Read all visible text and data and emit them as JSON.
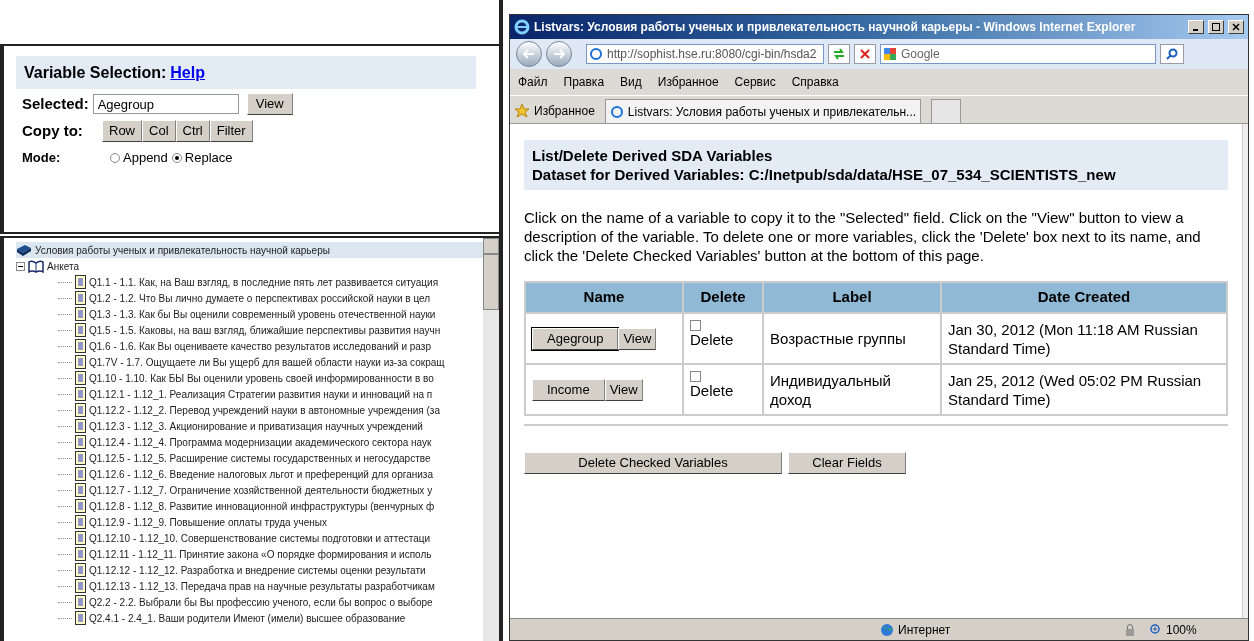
{
  "variable_selection": {
    "title": "Variable Selection:",
    "help_link": "Help",
    "selected_label": "Selected:",
    "selected_value": "Agegroup",
    "view_button": "View",
    "copy_label": "Copy to:",
    "copy_buttons": [
      "Row",
      "Col",
      "Ctrl",
      "Filter"
    ],
    "mode_label": "Mode:",
    "modes": [
      {
        "label": "Append",
        "selected": false
      },
      {
        "label": "Replace",
        "selected": true
      }
    ]
  },
  "tree": {
    "label": "Условия работы ученых и привлекательность научной карьеры",
    "children": [
      {
        "label": "Анкета",
        "expanded": true,
        "children": [
          {
            "label": "Q1.1 - 1.1. Как, на Ваш взгляд, в последние пять лет развивается ситуация"
          },
          {
            "label": "Q1.2 - 1.2. Что Вы лично думаете о перспективах российской науки в цел"
          },
          {
            "label": "Q1.3 - 1.3. Как бы Вы оценили современный уровень отечественной науки"
          },
          {
            "label": "Q1.5 - 1.5. Каковы, на ваш взгляд, ближайшие перспективы развития научн"
          },
          {
            "label": "Q1.6 - 1.6. Как Вы оцениваете качество результатов исследований и разр"
          },
          {
            "label": "Q1.7V - 1.7. Ощущаете ли Вы ущерб для вашей области науки из-за сокращ"
          },
          {
            "label": "Q1.10 - 1.10. Как БЫ Вы оценили уровень своей информированности в во"
          },
          {
            "label": "Q1.12.1 - 1.12_1. Реализация Стратегии развития науки и инноваций на п"
          },
          {
            "label": "Q1.12.2 - 1.12_2. Перевод учреждений науки в автономные учреждения (за"
          },
          {
            "label": "Q1.12.3 - 1.12_3. Акционирование и приватизация научных учреждений"
          },
          {
            "label": "Q1.12.4 - 1.12_4. Программа модернизации академического сектора наук"
          },
          {
            "label": "Q1.12.5 - 1.12_5. Расширение системы государственных и негосударстве"
          },
          {
            "label": "Q1.12.6 - 1.12_6. Введение налоговых льгот и преференций для организа"
          },
          {
            "label": "Q1.12.7 - 1.12_7. Ограничение хозяйственной деятельности бюджетных у"
          },
          {
            "label": "Q1.12.8 - 1.12_8. Развитие инновационной инфраструктуры (венчурных ф"
          },
          {
            "label": "Q1.12.9 - 1.12_9. Повышение оплаты труда ученых"
          },
          {
            "label": "Q1.12.10 - 1.12_10. Совершенствование системы подготовки и аттестаци"
          },
          {
            "label": "Q1.12.11 - 1.12_11. Принятие закона «О порядке формирования и исполь"
          },
          {
            "label": "Q1.12.12 - 1.12_12. Разработка и внедрение системы оценки результати"
          },
          {
            "label": "Q1.12.13 - 1.12_13. Передача прав на научные результаты разработчикам"
          },
          {
            "label": "Q2.2 - 2.2. Выбрали бы Вы профессию ученого, если бы вопрос о выборе"
          },
          {
            "label": "Q2.4.1 - 2.4_1. Ваши родители Имеют (имели) высшее образование"
          }
        ]
      }
    ]
  },
  "browser": {
    "title": "Listvars: Условия работы ученых и привлекательность научной карьеры - Windows Internet Explorer",
    "address": "http://sophist.hse.ru:8080/cgi-bin/hsda2",
    "search_placeholder": "Google",
    "menu": [
      "Файл",
      "Правка",
      "Вид",
      "Избранное",
      "Сервис",
      "Справка"
    ],
    "favorites": "Избранное",
    "tab": "Listvars: Условия работы ученых и привлекательн...",
    "status_zone": "Интернет",
    "zoom": "100%"
  },
  "page": {
    "heading": "List/Delete Derived SDA Variables",
    "dataset": "Dataset for Derived Variables: C:/Inetpub/sda/data/HSE_07_534_SCIENTISTS_new",
    "instructions": "Click on the name of a variable to copy it to the \"Selected\" field. Click on the \"View\" button to view a description of the variable. To delete one or more variables, click the 'Delete' box next to its name, and click the 'Delete Checked Variables' button at the bottom of this page.",
    "table": {
      "columns": [
        "Name",
        "Delete",
        "Label",
        "Date Created"
      ],
      "rows": [
        {
          "name": "Agegroup",
          "view": "View",
          "delete_checked": false,
          "delete": "Delete",
          "label": "Возрастные группы",
          "date": "Jan 30, 2012 (Mon 11:18 AM Russian Standard Time)",
          "focused": true
        },
        {
          "name": "Income",
          "view": "View",
          "delete_checked": false,
          "delete": "Delete",
          "label": "Индивидуальный доход",
          "date": "Jan 25, 2012 (Wed 05:02 PM Russian Standard Time)",
          "focused": false
        }
      ]
    },
    "buttons": [
      "Delete Checked Variables",
      "Clear Fields"
    ]
  }
}
